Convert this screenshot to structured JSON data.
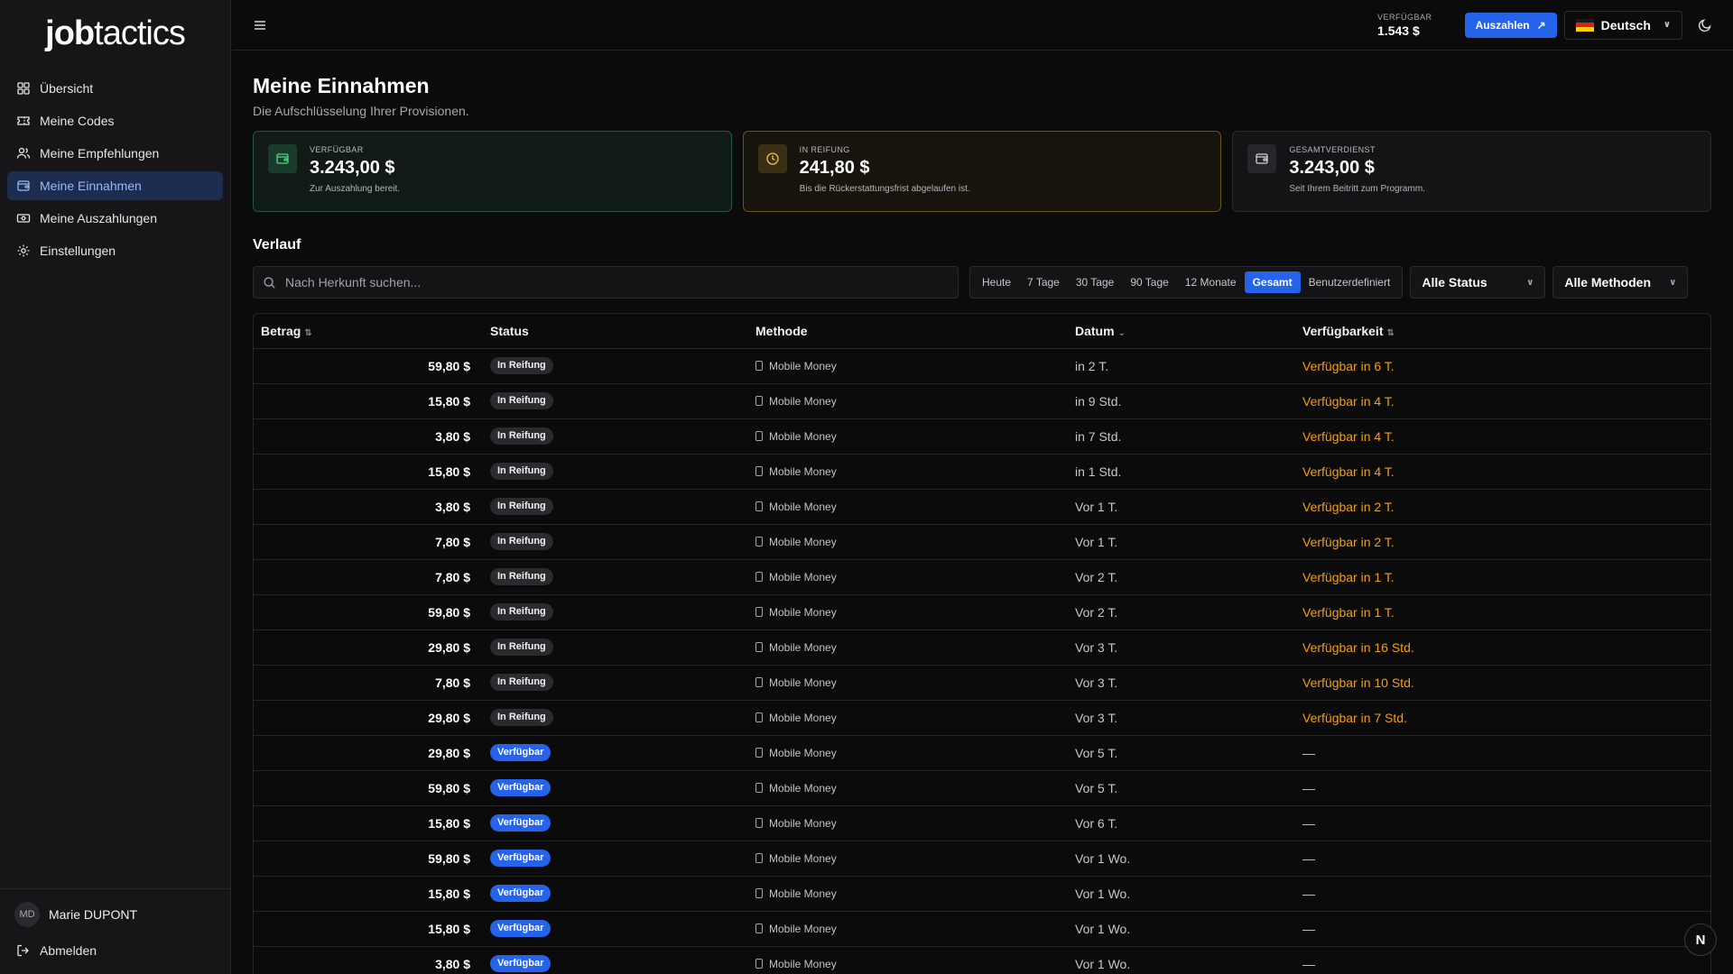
{
  "logo": {
    "bold": "job",
    "rest": "tactics"
  },
  "sidebar": {
    "items": [
      {
        "label": "Übersicht",
        "icon": "grid-icon",
        "active": false
      },
      {
        "label": "Meine Codes",
        "icon": "ticket-icon",
        "active": false
      },
      {
        "label": "Meine Empfehlungen",
        "icon": "users-icon",
        "active": false
      },
      {
        "label": "Meine Einnahmen",
        "icon": "wallet-icon",
        "active": true
      },
      {
        "label": "Meine Auszahlungen",
        "icon": "banknote-icon",
        "active": false
      },
      {
        "label": "Einstellungen",
        "icon": "gear-icon",
        "active": false
      }
    ],
    "user": {
      "initials": "MD",
      "name": "Marie DUPONT"
    },
    "logout_label": "Abmelden"
  },
  "header": {
    "balance_label": "VERFÜGBAR",
    "balance_value": "1.543 $",
    "payout_label": "Auszahlen",
    "language": "Deutsch"
  },
  "main": {
    "title": "Meine Einnahmen",
    "subtitle": "Die Aufschlüsselung Ihrer Provisionen.",
    "cards": [
      {
        "label": "VERFÜGBAR",
        "value": "3.243,00 $",
        "desc": "Zur Auszahlung bereit."
      },
      {
        "label": "IN REIFUNG",
        "value": "241,80 $",
        "desc": "Bis die Rückerstattungsfrist abgelaufen ist."
      },
      {
        "label": "GESAMTVERDIENST",
        "value": "3.243,00 $",
        "desc": "Seit Ihrem Beitritt zum Programm."
      }
    ],
    "history_title": "Verlauf",
    "search_placeholder": "Nach Herkunft suchen...",
    "ranges": [
      "Heute",
      "7 Tage",
      "30 Tage",
      "90 Tage",
      "12 Monate",
      "Gesamt",
      "Benutzerdefiniert"
    ],
    "active_range": "Gesamt",
    "status_filter": "Alle Status",
    "method_filter": "Alle Methoden",
    "table": {
      "headers": [
        "Betrag",
        "Status",
        "Methode",
        "Datum",
        "Verfügbarkeit"
      ],
      "rows": [
        {
          "amount": "59,80 $",
          "status": "In Reifung",
          "method": "Mobile Money",
          "date": "in 2 T.",
          "availability": "Verfügbar in 6 T."
        },
        {
          "amount": "15,80 $",
          "status": "In Reifung",
          "method": "Mobile Money",
          "date": "in 9 Std.",
          "availability": "Verfügbar in 4 T."
        },
        {
          "amount": "3,80 $",
          "status": "In Reifung",
          "method": "Mobile Money",
          "date": "in 7 Std.",
          "availability": "Verfügbar in 4 T."
        },
        {
          "amount": "15,80 $",
          "status": "In Reifung",
          "method": "Mobile Money",
          "date": "in 1 Std.",
          "availability": "Verfügbar in 4 T."
        },
        {
          "amount": "3,80 $",
          "status": "In Reifung",
          "method": "Mobile Money",
          "date": "Vor 1 T.",
          "availability": "Verfügbar in 2 T."
        },
        {
          "amount": "7,80 $",
          "status": "In Reifung",
          "method": "Mobile Money",
          "date": "Vor 1 T.",
          "availability": "Verfügbar in 2 T."
        },
        {
          "amount": "7,80 $",
          "status": "In Reifung",
          "method": "Mobile Money",
          "date": "Vor 2 T.",
          "availability": "Verfügbar in 1 T."
        },
        {
          "amount": "59,80 $",
          "status": "In Reifung",
          "method": "Mobile Money",
          "date": "Vor 2 T.",
          "availability": "Verfügbar in 1 T."
        },
        {
          "amount": "29,80 $",
          "status": "In Reifung",
          "method": "Mobile Money",
          "date": "Vor 3 T.",
          "availability": "Verfügbar in 16 Std."
        },
        {
          "amount": "7,80 $",
          "status": "In Reifung",
          "method": "Mobile Money",
          "date": "Vor 3 T.",
          "availability": "Verfügbar in 10 Std."
        },
        {
          "amount": "29,80 $",
          "status": "In Reifung",
          "method": "Mobile Money",
          "date": "Vor 3 T.",
          "availability": "Verfügbar in 7 Std."
        },
        {
          "amount": "29,80 $",
          "status": "Verfügbar",
          "method": "Mobile Money",
          "date": "Vor 5 T.",
          "availability": "—"
        },
        {
          "amount": "59,80 $",
          "status": "Verfügbar",
          "method": "Mobile Money",
          "date": "Vor 5 T.",
          "availability": "—"
        },
        {
          "amount": "15,80 $",
          "status": "Verfügbar",
          "method": "Mobile Money",
          "date": "Vor 6 T.",
          "availability": "—"
        },
        {
          "amount": "59,80 $",
          "status": "Verfügbar",
          "method": "Mobile Money",
          "date": "Vor 1 Wo.",
          "availability": "—"
        },
        {
          "amount": "15,80 $",
          "status": "Verfügbar",
          "method": "Mobile Money",
          "date": "Vor 1 Wo.",
          "availability": "—"
        },
        {
          "amount": "15,80 $",
          "status": "Verfügbar",
          "method": "Mobile Money",
          "date": "Vor 1 Wo.",
          "availability": "—"
        },
        {
          "amount": "3,80 $",
          "status": "Verfügbar",
          "method": "Mobile Money",
          "date": "Vor 1 Wo.",
          "availability": "—"
        }
      ]
    }
  },
  "fab_label": "N",
  "colors": {
    "accent": "#2563eb",
    "warning": "#f59e0b",
    "success": "#4ade80"
  }
}
